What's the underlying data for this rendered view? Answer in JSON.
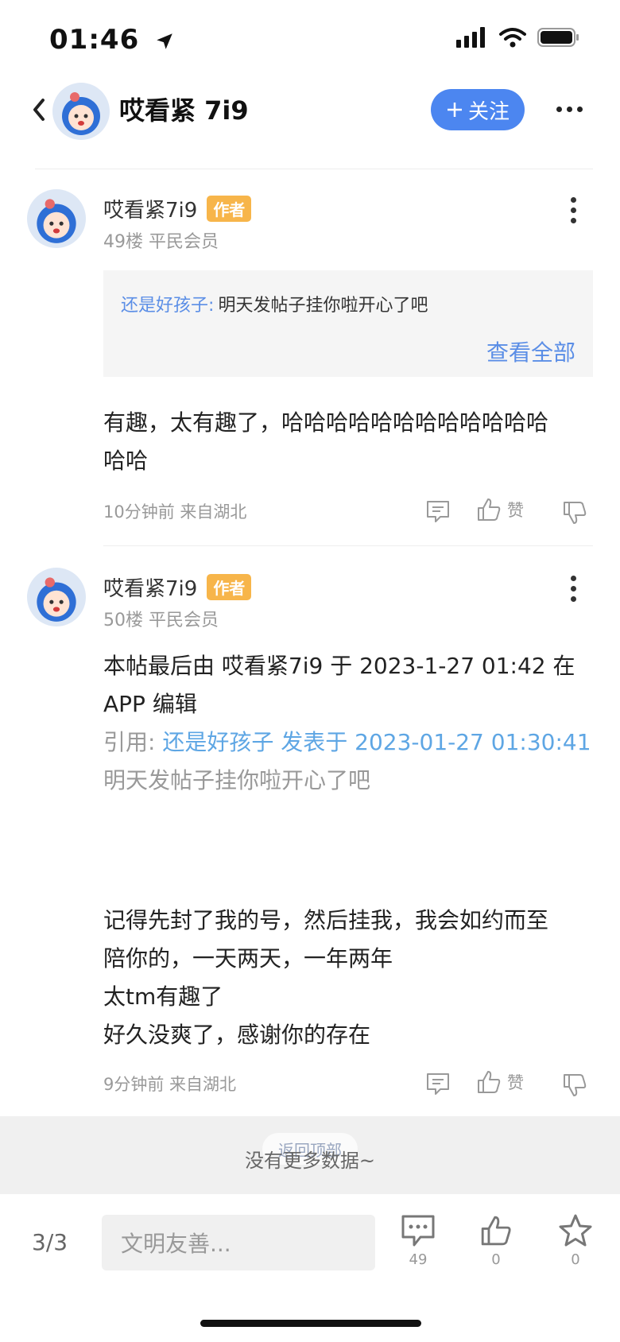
{
  "status_bar": {
    "time": "01:46"
  },
  "header": {
    "title": "哎看紧 7i9",
    "follow_label": "关注"
  },
  "posts": [
    {
      "username": "哎看紧7i9",
      "badge": "作者",
      "floor": "49楼 平民会员",
      "quote": {
        "name": "还是好孩子:",
        "text": "明天发帖子挂你啦开心了吧",
        "view_all": "查看全部"
      },
      "content": [
        "有趣，太有趣了，哈哈哈哈哈哈哈哈哈哈哈哈",
        "哈哈"
      ],
      "meta": "10分钟前 来自湖北",
      "like_label": "赞"
    },
    {
      "username": "哎看紧7i9",
      "badge": "作者",
      "floor": "50楼 平民会员",
      "edit_note": [
        "本帖最后由 哎看紧7i9 于 2023-1-27 01:42 在",
        "APP 编辑"
      ],
      "citation": {
        "prefix": "引用: ",
        "source": "还是好孩子 发表于 2023-01-27 01:30:41",
        "text": "明天发帖子挂你啦开心了吧"
      },
      "content": [
        "记得先封了我的号，然后挂我，我会如约而至",
        "陪你的，一天两天，一年两年",
        "太tm有趣了",
        "好久没爽了，感谢你的存在"
      ],
      "meta": "9分钟前 来自湖北",
      "like_label": "赞"
    }
  ],
  "footer_notice": {
    "back_to_top": "返回顶部",
    "no_more": "没有更多数据~"
  },
  "bottom_bar": {
    "page": "3/3",
    "input_placeholder": "文明友善...",
    "comment_count": "49",
    "like_count": "0",
    "star_count": "0"
  },
  "colors": {
    "accent": "#4c86f0",
    "badge": "#f7b54a",
    "link": "#5b8ee6"
  },
  "icons": [
    "location-arrow-icon",
    "signal-icon",
    "wifi-icon",
    "battery-icon",
    "back-chevron-icon",
    "plus-icon",
    "more-dots-icon",
    "comment-icon",
    "thumbs-up-icon",
    "thumbs-down-icon",
    "star-icon"
  ]
}
